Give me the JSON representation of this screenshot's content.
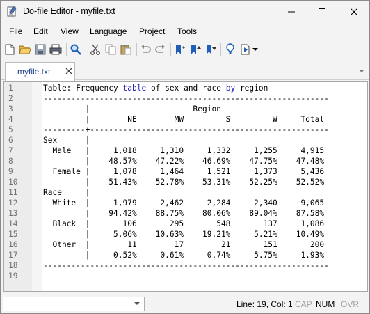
{
  "window": {
    "title": "Do-file Editor - myfile.txt"
  },
  "menu": [
    "File",
    "Edit",
    "View",
    "Language",
    "Project",
    "Tools"
  ],
  "toolbar": {
    "icons": [
      "new-file-icon",
      "open-folder-icon",
      "save-icon",
      "print-icon",
      "find-icon",
      "cut-icon",
      "copy-icon",
      "paste-icon",
      "undo-icon",
      "redo-icon",
      "toggle-bookmark-icon",
      "previous-bookmark-icon",
      "next-bookmark-icon",
      "show-file-in-viewer-icon",
      "execute-do-icon"
    ]
  },
  "tabs": [
    {
      "label": "myfile.txt",
      "active": true
    }
  ],
  "editor": {
    "lines": [
      {
        "n": "1",
        "segments": [
          {
            "t": "Table: Frequency "
          },
          {
            "t": "table",
            "kw": true
          },
          {
            "t": " of sex and race "
          },
          {
            "t": "by",
            "kw": true
          },
          {
            "t": " region"
          }
        ]
      },
      {
        "n": "2",
        "segments": [
          {
            "t": "-------------------------------------------------------------"
          }
        ]
      },
      {
        "n": "3",
        "segments": [
          {
            "t": "         |                      Region"
          }
        ]
      },
      {
        "n": "4",
        "segments": [
          {
            "t": "         |        NE        MW         S         W     Total"
          }
        ]
      },
      {
        "n": "5",
        "segments": [
          {
            "t": "---------+---------------------------------------------------"
          }
        ]
      },
      {
        "n": "6",
        "segments": [
          {
            "t": "Sex      |"
          }
        ]
      },
      {
        "n": "7",
        "segments": [
          {
            "t": "  Male   |     1,018     1,310     1,332     1,255     4,915"
          }
        ]
      },
      {
        "n": "8",
        "segments": [
          {
            "t": "         |    48.57%    47.22%    46.69%    47.75%    47.48%"
          }
        ]
      },
      {
        "n": "9",
        "segments": [
          {
            "t": "  Female |     1,078     1,464     1,521     1,373     5,436"
          }
        ]
      },
      {
        "n": "10",
        "segments": [
          {
            "t": "         |    51.43%    52.78%    53.31%    52.25%    52.52%"
          }
        ]
      },
      {
        "n": "11",
        "segments": [
          {
            "t": "Race     |"
          }
        ]
      },
      {
        "n": "12",
        "segments": [
          {
            "t": "  White  |     1,979     2,462     2,284     2,340     9,065"
          }
        ]
      },
      {
        "n": "13",
        "segments": [
          {
            "t": "         |    94.42%    88.75%    80.06%    89.04%    87.58%"
          }
        ]
      },
      {
        "n": "14",
        "segments": [
          {
            "t": "  Black  |       106       295       548       137     1,086"
          }
        ]
      },
      {
        "n": "15",
        "segments": [
          {
            "t": "         |     5.06%    10.63%    19.21%     5.21%    10.49%"
          }
        ]
      },
      {
        "n": "16",
        "segments": [
          {
            "t": "  Other  |        11        17        21       151       200"
          }
        ]
      },
      {
        "n": "17",
        "segments": [
          {
            "t": "         |     0.52%     0.61%     0.74%     5.75%     1.93%"
          }
        ]
      },
      {
        "n": "18",
        "segments": [
          {
            "t": "-------------------------------------------------------------"
          }
        ]
      },
      {
        "n": "19",
        "segments": [
          {
            "t": ""
          }
        ]
      }
    ]
  },
  "status": {
    "selector_value": "",
    "position": "Line: 19, Col: 1",
    "cap": "CAP",
    "num": "NUM",
    "ovr": "OVR"
  },
  "colors": {
    "keyword": "#1c1cb0",
    "tab_text": "#1a3f8a",
    "disabled_indicator": "#a0a0a0"
  }
}
